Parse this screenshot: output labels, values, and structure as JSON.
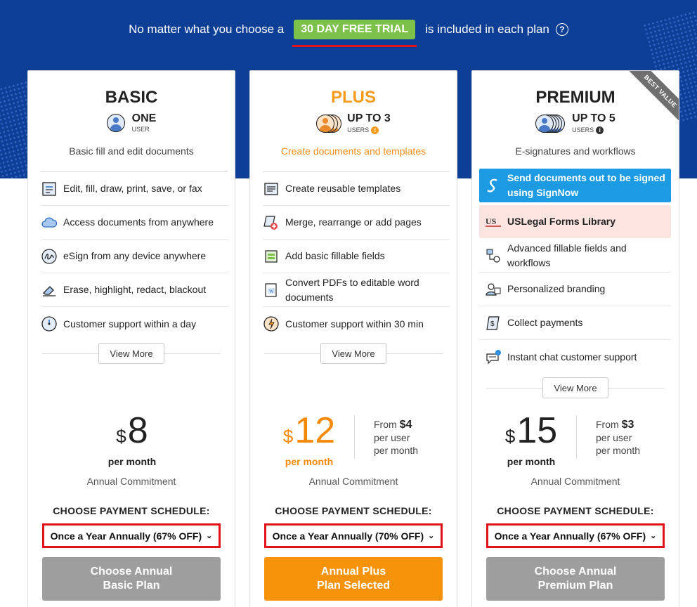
{
  "banner": {
    "before": "No matter what you choose a",
    "trial": "30 DAY FREE TRIAL",
    "after": "is included in each plan",
    "help_icon": "?"
  },
  "colors": {
    "hero_bg": "#0d3f97",
    "trial_green": "#7cc24a",
    "plus_orange": "#f79b1b",
    "highlight_red": "#e3131b",
    "signnow_blue": "#1d9be2"
  },
  "plans": [
    {
      "name": "BASIC",
      "users_count": "ONE",
      "users_label": "USER",
      "tagline": "Basic fill and edit documents",
      "features": [
        {
          "icon": "edit-form-icon",
          "text": "Edit, fill, draw, print, save, or fax"
        },
        {
          "icon": "cloud-icon",
          "text": "Access documents from anywhere"
        },
        {
          "icon": "signature-icon",
          "text": "eSign from any device anywhere"
        },
        {
          "icon": "eraser-icon",
          "text": "Erase, highlight, redact, blackout"
        },
        {
          "icon": "clock-icon",
          "text": "Customer support within a day"
        }
      ],
      "view_more": "View More",
      "currency": "$",
      "price": "8",
      "per": "per month",
      "commitment": "Annual Commitment",
      "choose_label": "CHOOSE PAYMENT SCHEDULE:",
      "schedule": "Once a Year Annually (67% OFF)",
      "cta_line1": "Choose Annual",
      "cta_line2": "Basic Plan"
    },
    {
      "name": "PLUS",
      "users_count": "UP TO 3",
      "users_label": "USERS",
      "tagline": "Create documents and templates",
      "features": [
        {
          "icon": "template-icon",
          "text": "Create reusable templates"
        },
        {
          "icon": "merge-pages-icon",
          "text": "Merge, rearrange or add pages"
        },
        {
          "icon": "fillable-field-icon",
          "text": "Add basic fillable fields"
        },
        {
          "icon": "word-doc-icon",
          "text": "Convert PDFs to editable word documents"
        },
        {
          "icon": "fast-clock-icon",
          "text": "Customer support within 30 min"
        }
      ],
      "view_more": "View More",
      "currency": "$",
      "price": "12",
      "per": "per month",
      "from_label": "From",
      "from_price": "$4",
      "per_user": "per user",
      "per_month2": "per month",
      "commitment": "Annual Commitment",
      "choose_label": "CHOOSE PAYMENT SCHEDULE:",
      "schedule": "Once a Year Annually (70% OFF)",
      "cta_line1": "Annual Plus",
      "cta_line2": "Plan Selected"
    },
    {
      "name": "PREMIUM",
      "badge": "BEST VALUE",
      "users_count": "UP TO 5",
      "users_label": "USERS",
      "tagline": "E-signatures and workflows",
      "features": [
        {
          "icon": "signnow-icon",
          "text": "Send documents out to be signed using SignNow"
        },
        {
          "icon": "uslegal-icon",
          "text": "USLegal Forms Library"
        },
        {
          "icon": "workflow-icon",
          "text": "Advanced fillable fields and workflows"
        },
        {
          "icon": "branding-icon",
          "text": "Personalized branding"
        },
        {
          "icon": "payment-icon",
          "text": "Collect payments"
        },
        {
          "icon": "chat-icon",
          "text": "Instant chat customer support"
        }
      ],
      "view_more": "View More",
      "currency": "$",
      "price": "15",
      "per": "per month",
      "from_label": "From",
      "from_price": "$3",
      "per_user": "per user",
      "per_month2": "per month",
      "commitment": "Annual Commitment",
      "choose_label": "CHOOSE PAYMENT SCHEDULE:",
      "schedule": "Once a Year Annually (67% OFF)",
      "cta_line1": "Choose Annual",
      "cta_line2": "Premium Plan"
    }
  ]
}
